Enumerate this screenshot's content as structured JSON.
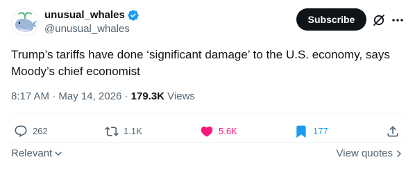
{
  "author": {
    "display_name": "unusual_whales",
    "handle": "@unusual_whales",
    "verified": true
  },
  "subscribe_label": "Subscribe",
  "tweet_text": "Trump’s tariffs have done ‘significant damage’ to the U.S. economy, says Moody’s chief economist",
  "meta": {
    "time": "8:17 AM",
    "separator1": " · ",
    "date": "May 14, 2026",
    "separator2": " · ",
    "views_count": "179.3K",
    "views_label": " Views"
  },
  "actions": {
    "replies": "262",
    "reposts": "1.1K",
    "likes": "5.6K",
    "bookmarks": "177"
  },
  "bottom": {
    "relevant": "Relevant",
    "view_quotes": "View quotes"
  },
  "colors": {
    "verified": "#1d9bf0",
    "like_active": "#f91880",
    "bookmark_active": "#1d9bf0",
    "muted": "#536471",
    "button": "#0f1419"
  },
  "icons": [
    "whale-avatar-icon",
    "verified-badge-icon",
    "grok-icon",
    "more-icon",
    "reply-icon",
    "repost-icon",
    "heart-icon",
    "bookmark-icon",
    "share-icon",
    "chevron-down-icon",
    "chevron-right-icon"
  ]
}
